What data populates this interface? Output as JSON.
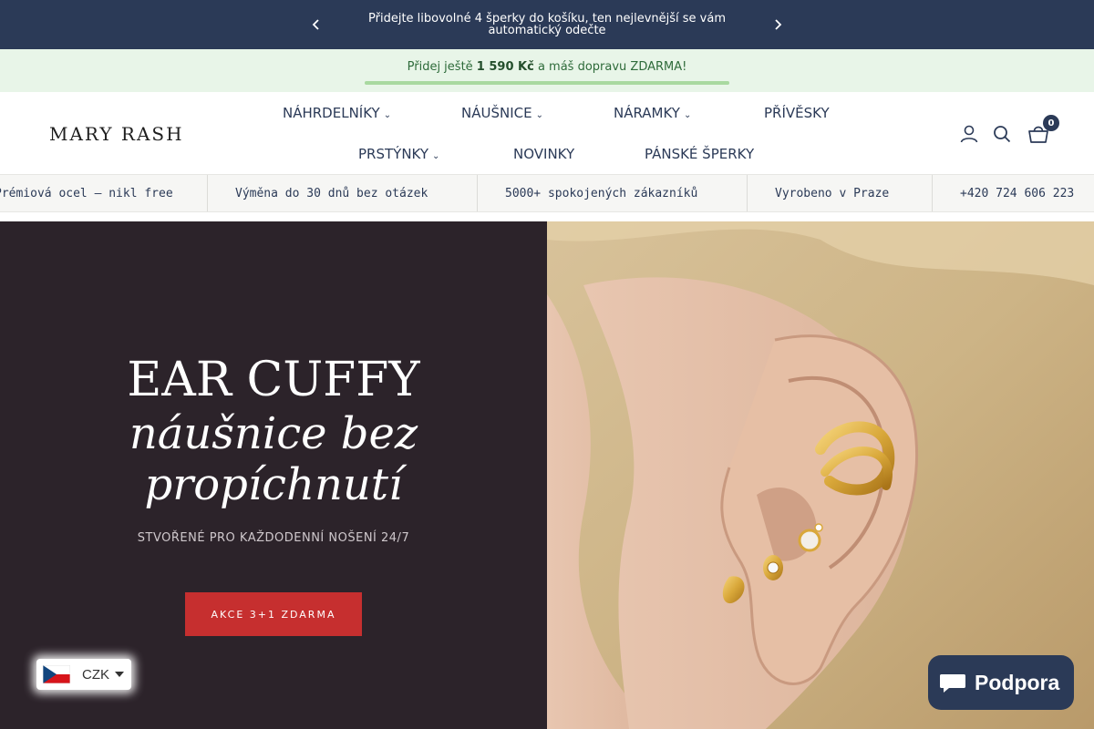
{
  "announcement": {
    "text": "Přidejte libovolné 4 šperky do košíku, ten nejlevnější se vám automatický odečte"
  },
  "shipping_bar": {
    "prefix": "Přidej ještě ",
    "amount": "1 590 Kč",
    "suffix": " a máš dopravu ZDARMA!",
    "progress_fraction": 1.0
  },
  "header": {
    "logo": "MARY RASH",
    "nav": [
      {
        "label": "NÁHRDELNÍKY",
        "has_dropdown": true
      },
      {
        "label": "NÁUŠNICE",
        "has_dropdown": true
      },
      {
        "label": "NÁRAMKY",
        "has_dropdown": true
      },
      {
        "label": "PŘÍVĚSKY",
        "has_dropdown": false
      },
      {
        "label": "PRSTÝNKY",
        "has_dropdown": true
      },
      {
        "label": "NOVINKY",
        "has_dropdown": false
      },
      {
        "label": "PÁNSKÉ ŠPERKY",
        "has_dropdown": false
      }
    ],
    "cart_count": "0"
  },
  "usp": [
    {
      "icon": "",
      "text": "Prémiová ocel — nikl free"
    },
    {
      "icon": "",
      "text": "Výměna do 30 dnů bez otázek"
    },
    {
      "icon": "",
      "text": "5000+ spokojených zákazníků"
    },
    {
      "icon": "",
      "text": "Vyrobeno v Praze"
    },
    {
      "icon": "",
      "text": "+420 724 606 223"
    }
  ],
  "hero": {
    "title": "EAR CUFFY",
    "subtitle_line1": "náušnice bez",
    "subtitle_line2": "propíchnutí",
    "tagline": "STVOŘENÉ PRO KAŽDODENNÍ NOŠENÍ 24/7",
    "button": "AKCE 3+1 ZDARMA"
  },
  "currency": {
    "code": "CZK"
  },
  "support": {
    "label": "Podpora"
  },
  "colors": {
    "navy": "#2b3a57",
    "hero_dark": "#2c232a",
    "cta_red": "#c62f2f",
    "ship_green_bg": "#e8f5e8"
  }
}
